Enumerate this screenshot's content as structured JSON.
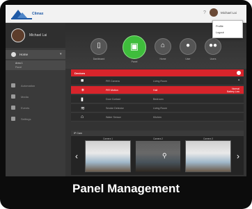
{
  "topbar": {
    "logo_text": "Climax",
    "help_glyph": "?",
    "user_name": "Michael Lai",
    "dropdown_items": [
      "Profile",
      "Logout"
    ]
  },
  "sidebar": {
    "user_name": "Michael Lai",
    "home_label": "Home",
    "sub_title": "Area 1",
    "sub_body": "Panel",
    "items": [
      {
        "label": "Automation",
        "icon": "automation-icon"
      },
      {
        "label": "Media",
        "icon": "media-icon"
      },
      {
        "label": "Events",
        "icon": "events-icon"
      },
      {
        "label": "Settings",
        "icon": "settings-icon"
      }
    ]
  },
  "hero": {
    "tabs": [
      {
        "label": "Dashboard",
        "icon": "door-icon",
        "active": false
      },
      {
        "label": "Panel",
        "icon": "panel-icon",
        "active": true
      },
      {
        "label": "Home",
        "icon": "house-icon",
        "active": false
      },
      {
        "label": "User",
        "icon": "user-icon",
        "active": false
      },
      {
        "label": "Users",
        "icon": "users-icon",
        "active": false
      }
    ]
  },
  "panel": {
    "title": "Devices",
    "rows": [
      {
        "icon": "camera-icon",
        "name": "PIR Camera",
        "location": "Living Room",
        "status": "",
        "selected": false
      },
      {
        "icon": "running-man-icon",
        "name": "PIR Motion",
        "location": "Hall",
        "status": "Normal\nBattery Low",
        "selected": true
      },
      {
        "icon": "door-contact-icon",
        "name": "Door Contact",
        "location": "Bedroom",
        "status": "",
        "selected": false
      },
      {
        "icon": "smoke-icon",
        "name": "Smoke Detector",
        "location": "Living Room",
        "status": "",
        "selected": false
      },
      {
        "icon": "home-icon",
        "name": "Water Sensor",
        "location": "Kitchen",
        "status": "",
        "selected": false
      }
    ]
  },
  "ipcam": {
    "title": "IP Cam",
    "cams": [
      "Camera 1",
      "Camera 2",
      "Camera 3"
    ]
  },
  "caption": "Panel Management",
  "colors": {
    "accent_red": "#d8242b",
    "accent_green": "#3fbd3c"
  }
}
